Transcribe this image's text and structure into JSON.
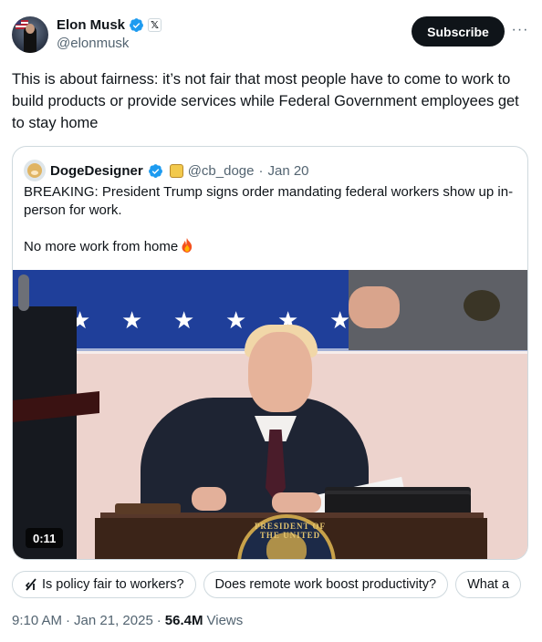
{
  "author": {
    "display_name": "Elon Musk",
    "handle": "@elonmusk",
    "verified_color": "#1d9bf0"
  },
  "actions": {
    "subscribe_label": "Subscribe",
    "more_label": "···"
  },
  "tweet": {
    "text": "This is about fairness: it’s not fair that most people have to come to work to build products or provide services while Federal Government employees get to stay home"
  },
  "quote": {
    "display_name": "DogeDesigner",
    "handle": "@cb_doge",
    "separator": "·",
    "date": "Jan 20",
    "line1": "BREAKING: President Trump signs order mandating federal workers show up in-person for work.",
    "line2": "No more work from home",
    "video_duration": "0:11",
    "seal_text": "PRESIDENT OF THE UNITED"
  },
  "grok_chips": [
    {
      "icon": "grok-icon",
      "label": "Is policy fair to workers?"
    },
    {
      "label": "Does remote work boost productivity?"
    },
    {
      "label": "What a"
    }
  ],
  "meta": {
    "time": "9:10 AM",
    "separator": "·",
    "date": "Jan 21, 2025",
    "separator2": "·",
    "views_count": "56.4M",
    "views_label": "Views"
  }
}
